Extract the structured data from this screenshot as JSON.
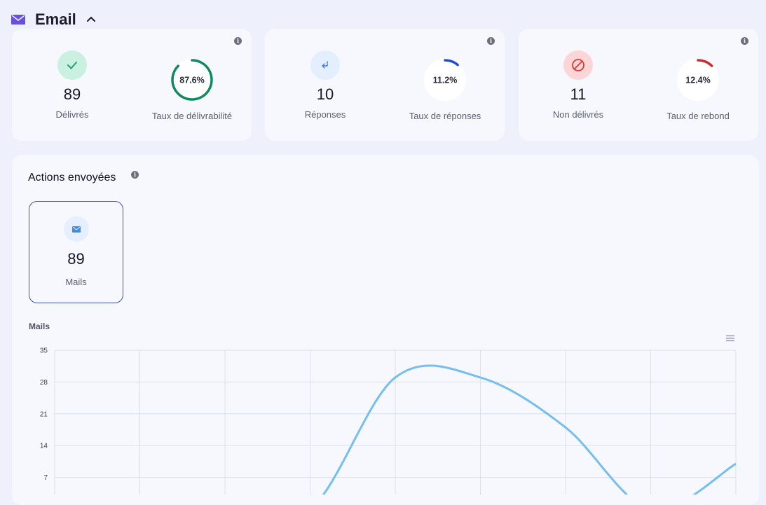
{
  "header": {
    "title": "Email",
    "icon": "mail-icon",
    "toggle_icon": "chevron-up-icon",
    "accent": "#6a4fd8"
  },
  "cards": [
    {
      "stat": {
        "value": "89",
        "label": "Délivrés",
        "icon": "check-icon",
        "bubble_color": "#c9f0e0",
        "icon_color": "#1aa673"
      },
      "ratio": {
        "value_text": "87.6%",
        "fraction": 0.876,
        "label": "Taux de délivrabilité",
        "color": "#0f8a5f"
      }
    },
    {
      "stat": {
        "value": "10",
        "label": "Réponses",
        "icon": "reply-icon",
        "bubble_color": "#e3eefe",
        "icon_color": "#3d7de0"
      },
      "ratio": {
        "value_text": "11.2%",
        "fraction": 0.112,
        "label": "Taux de réponses",
        "color": "#1f4fd1"
      }
    },
    {
      "stat": {
        "value": "11",
        "label": "Non délivrés",
        "icon": "block-icon",
        "bubble_color": "#fcd6d6",
        "icon_color": "#d83a3a"
      },
      "ratio": {
        "value_text": "12.4%",
        "fraction": 0.124,
        "label": "Taux de rebond",
        "color": "#cf2a2a"
      }
    }
  ],
  "actions": {
    "title": "Actions envoyées",
    "items": [
      {
        "value": "89",
        "label": "Mails",
        "icon": "mail-icon"
      }
    ]
  },
  "chart_data": {
    "type": "line",
    "title": "Mails",
    "ylim": [
      0,
      35
    ],
    "yticks": [
      7,
      14,
      21,
      28,
      35
    ],
    "grid": true,
    "series": [
      {
        "color": "#74bff0",
        "values": [
          0,
          0,
          0,
          0,
          29,
          29,
          18,
          0,
          10
        ]
      },
      {
        "color": "#f7b6a6",
        "values": [
          0,
          0,
          0,
          0,
          0.5,
          0.5,
          0,
          0,
          0
        ]
      }
    ]
  }
}
